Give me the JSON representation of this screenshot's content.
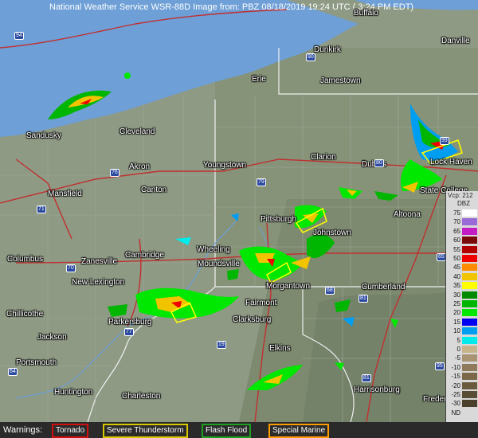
{
  "header": {
    "title": "National Weather Service WSR-88D Image from: PBZ 08/18/2019 19:24 UTC ( 3:24 PM EDT)"
  },
  "cities": [
    "Buffalo",
    "Dunkirk",
    "Jamestown",
    "Erie",
    "Sandusky",
    "Cleveland",
    "Akron",
    "Youngstown",
    "Canton",
    "Mansfield",
    "Clarion",
    "Dubois",
    "Lock Haven",
    "State College",
    "Altoona",
    "Pittsburgh",
    "Johnstown",
    "Columbus",
    "Zanesville",
    "Cambridge",
    "Wheeling",
    "Moundsville",
    "New Lexington",
    "Morgantown",
    "Cumberland",
    "Chillicothe",
    "Parkersburg",
    "Fairmont",
    "Clarksburg",
    "Jackson",
    "Portsmouth",
    "Elkins",
    "Huntington",
    "Charleston",
    "Harrisonburg",
    "Fredericks",
    "Danville"
  ],
  "highway_shields": [
    "94",
    "90",
    "79",
    "71",
    "76",
    "70",
    "77",
    "81",
    "68",
    "64",
    "99",
    "80",
    "95",
    "19",
    "65",
    "81"
  ],
  "legend": {
    "header": "Vcp: 212",
    "unit": "DBZ",
    "entries": [
      {
        "label": "75",
        "color": "#ffffff"
      },
      {
        "label": "70",
        "color": "#9a6bd6"
      },
      {
        "label": "65",
        "color": "#c41cc4"
      },
      {
        "label": "60",
        "color": "#7a0a0a"
      },
      {
        "label": "55",
        "color": "#b20000"
      },
      {
        "label": "50",
        "color": "#f10000"
      },
      {
        "label": "45",
        "color": "#ff8c00"
      },
      {
        "label": "40",
        "color": "#f2c400"
      },
      {
        "label": "35",
        "color": "#ffff00"
      },
      {
        "label": "30",
        "color": "#008a00"
      },
      {
        "label": "25",
        "color": "#00b600"
      },
      {
        "label": "20",
        "color": "#00e800"
      },
      {
        "label": "15",
        "color": "#0000f0"
      },
      {
        "label": "10",
        "color": "#009ef0"
      },
      {
        "label": "5",
        "color": "#00ecec"
      },
      {
        "label": "0",
        "color": "#c8b48a"
      },
      {
        "label": "-5",
        "color": "#a89472"
      },
      {
        "label": "-10",
        "color": "#8f7a5c"
      },
      {
        "label": "-15",
        "color": "#7a6848"
      },
      {
        "label": "-20",
        "color": "#6a5a3e"
      },
      {
        "label": "-25",
        "color": "#5a4d35"
      },
      {
        "label": "-30",
        "color": "#4a402c"
      },
      {
        "label": "ND",
        "color": "#d9d9d9"
      }
    ]
  },
  "warnings": {
    "label": "Warnings:",
    "items": [
      {
        "label": "Tornado",
        "color": "#d01010"
      },
      {
        "label": "Severe Thunderstorm",
        "color": "#d8c800"
      },
      {
        "label": "Flash Flood",
        "color": "#20a020"
      },
      {
        "label": "Special Marine",
        "color": "#ff9a00"
      }
    ]
  }
}
